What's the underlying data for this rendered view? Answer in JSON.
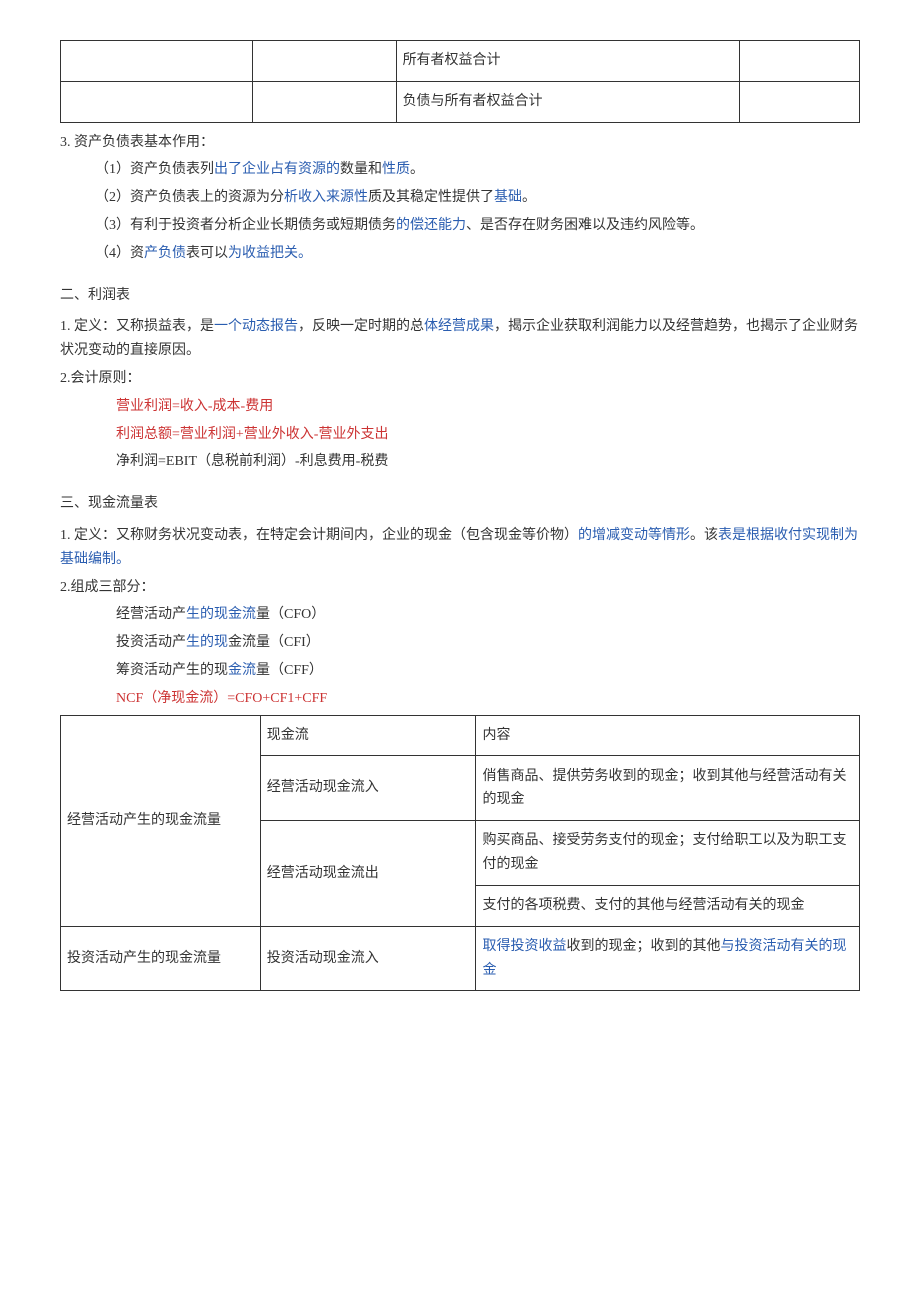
{
  "table1": {
    "rows": [
      {
        "c1": "",
        "c2": "",
        "c3": "所有者权益合计",
        "c4": ""
      },
      {
        "c1": "",
        "c2": "",
        "c3": "负债与所有者权益合计",
        "c4": ""
      }
    ]
  },
  "sec3": {
    "title": "3. 资产负债表基本作用：",
    "items": [
      {
        "runs": [
          {
            "t": "（1）资产负债表列"
          },
          {
            "t": "出了企业占有资源的",
            "cls": "blue"
          },
          {
            "t": "数量和"
          },
          {
            "t": "性质",
            "cls": "blue"
          },
          {
            "t": "。"
          }
        ]
      },
      {
        "runs": [
          {
            "t": "（2）资产负债表上的资源为分"
          },
          {
            "t": "析收入来源性",
            "cls": "blue"
          },
          {
            "t": "质及其稳定性提供了"
          },
          {
            "t": "基础",
            "cls": "blue"
          },
          {
            "t": "。"
          }
        ]
      },
      {
        "runs": [
          {
            "t": "（3）有利于投资者分析企业长期债务或短期债务"
          },
          {
            "t": "的偿还能力",
            "cls": "blue"
          },
          {
            "t": "、是否存在财务困难以及违约风险等。"
          }
        ]
      },
      {
        "runs": [
          {
            "t": "（4）资"
          },
          {
            "t": "产负债",
            "cls": "blue"
          },
          {
            "t": "表可以"
          },
          {
            "t": "为收益把关。",
            "cls": "blue"
          }
        ]
      }
    ]
  },
  "sec_profit": {
    "head": "二、利润表",
    "p1_runs": [
      {
        "t": "1. 定义：又称损益表，是"
      },
      {
        "t": "一个动态报告",
        "cls": "blue"
      },
      {
        "t": "，反映一定时期的总"
      },
      {
        "t": "体经营成果",
        "cls": "blue"
      },
      {
        "t": "，揭示企业获取利润能力以及经营趋势，也揭示了企业财务状况变动的直接原因。"
      }
    ],
    "p2": "2.会计原则：",
    "formulas": [
      {
        "t": "营业利润=收入-成本-费用",
        "cls": "red"
      },
      {
        "t": "利润总额=营业利润+营业外收入-营业外支出",
        "cls": "red"
      },
      {
        "t": "净利润=EBIT（息税前利润）-利息费用-税费",
        "cls": ""
      }
    ]
  },
  "sec_cash": {
    "head": "三、现金流量表",
    "p1_runs": [
      {
        "t": "1. 定义：又称财务状况变动表，在特定会计期间内，企业的现金（包含现金等价物）"
      },
      {
        "t": "的增减变动等情形",
        "cls": "blue"
      },
      {
        "t": "。该"
      },
      {
        "t": "表是根据收付实现制为基础编制。",
        "cls": "blue"
      }
    ],
    "p2": "2.组成三部分：",
    "parts": [
      {
        "runs": [
          {
            "t": "经营活动产"
          },
          {
            "t": "生的现金流",
            "cls": "blue"
          },
          {
            "t": "量（CFO）"
          }
        ]
      },
      {
        "runs": [
          {
            "t": "投资活动产"
          },
          {
            "t": "生的现",
            "cls": "blue"
          },
          {
            "t": "金流量（CFI）"
          }
        ]
      },
      {
        "runs": [
          {
            "t": "筹资活动产生的现"
          },
          {
            "t": "金流",
            "cls": "blue"
          },
          {
            "t": "量（CFF）"
          }
        ]
      }
    ],
    "ncf": "NCF（净现金流）=CFO+CF1+CFF"
  },
  "table2": {
    "header": {
      "c1": "",
      "c2": "现金流",
      "c3": "内容"
    },
    "group1": {
      "label": "经营活动产生的现金流量",
      "inflow_label": "经营活动现金流入",
      "inflow_content": "俏售商品、提供劳务收到的现金；收到其他与经营活动有关的现金",
      "outflow_label": "经营活动现金流出",
      "outflow_c1": "购买商品、接受劳务支付的现金；支付给职工以及为职工支付的现金",
      "outflow_c2": "支付的各项税费、支付的其他与经营活动有关的现金"
    },
    "group2": {
      "label": "投资活动产生的现金流量",
      "inflow_label": "投资活动现金流入",
      "inflow_runs": [
        {
          "t": "取得投资收益",
          "cls": "blue"
        },
        {
          "t": "收到的现金；收到的其他"
        },
        {
          "t": "与投资活动有关的现金",
          "cls": "blue"
        }
      ]
    }
  }
}
